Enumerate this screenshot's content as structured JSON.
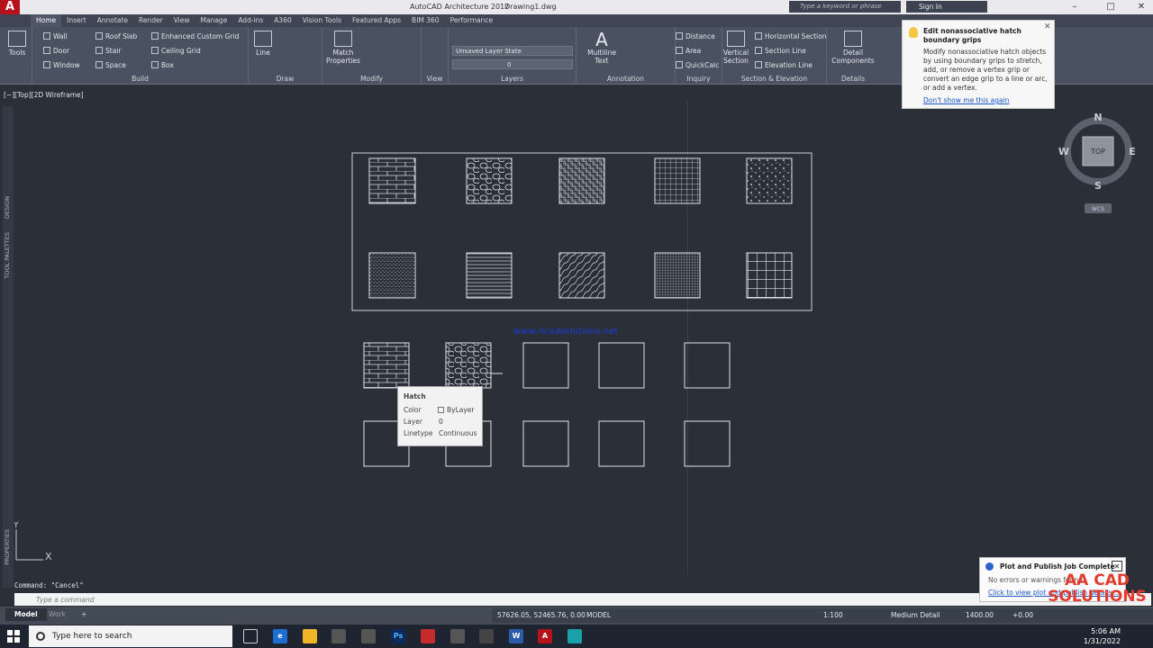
{
  "app": {
    "title": "AutoCAD Architecture 2017",
    "document": "Drawing1.dwg",
    "logo_letter": "A",
    "search_placeholder": "Type a keyword or phrase",
    "signin_label": "Sign In"
  },
  "tabs": [
    "Home",
    "Insert",
    "Annotate",
    "Render",
    "View",
    "Manage",
    "Add-ins",
    "A360",
    "Vision Tools",
    "Featured Apps",
    "BIM 360",
    "Performance"
  ],
  "ribbon": {
    "tools_label": "Tools",
    "build": {
      "label": "Build",
      "items": [
        "Wall",
        "Door",
        "Window",
        "Roof Slab",
        "Stair",
        "Space",
        "Enhanced Custom Grid",
        "Ceiling Grid",
        "Box"
      ]
    },
    "draw": {
      "label": "Draw",
      "line": "Line"
    },
    "modify": {
      "label": "Modify",
      "match_properties": "Match Properties"
    },
    "view": {
      "label": "View"
    },
    "layers": {
      "label": "Layers",
      "layer_state": "Unsaved Layer State",
      "current_layer": "0"
    },
    "annotation": {
      "label": "Annotation",
      "multiline_text": "Multiline Text"
    },
    "inquiry": {
      "label": "Inquiry",
      "items": [
        "Distance",
        "Area",
        "QuickCalc"
      ]
    },
    "section_elevation": {
      "label": "Section & Elevation",
      "vertical_section": "Vertical Section",
      "items": [
        "Horizontal Section",
        "Section Line",
        "Elevation Line"
      ]
    },
    "details": {
      "label": "Details",
      "detail_components": "Detail Components"
    }
  },
  "viewport": {
    "label": "[−][Top][2D Wireframe]",
    "viewcube": {
      "n": "N",
      "s": "S",
      "e": "E",
      "w": "W",
      "top": "TOP",
      "wcs": "WCS"
    },
    "ucs_y": "Y",
    "ucs_x": "X",
    "url_text": "www.ricadsolutions.net"
  },
  "palettes": {
    "design": "DESIGN",
    "tool_palettes": "TOOL PALETTES",
    "properties": "PROPERTIES"
  },
  "tooltip_grips": {
    "title": "Edit nonassociative hatch boundary grips",
    "body": "Modify nonassociative hatch objects by using boundary grips to stretch, add, or remove a vertex grip or convert an edge grip to a line or arc, or add a vertex.",
    "link": "Don't show me this again"
  },
  "hatch_tip": {
    "title": "Hatch",
    "rows": [
      {
        "k": "Color",
        "v": "ByLayer"
      },
      {
        "k": "Layer",
        "v": "0"
      },
      {
        "k": "Linetype",
        "v": "Continuous"
      }
    ]
  },
  "command": {
    "history": "Command: \"Cancel\"",
    "placeholder": "Type a command"
  },
  "layout_tabs": [
    "Model",
    "Work",
    "+"
  ],
  "status": {
    "coords": "57626.05, 52465.76, 0.00",
    "space": "MODEL",
    "scale": "1:100",
    "detail": "Medium Detail",
    "elevation": "1400.00",
    "offset": "+0.00"
  },
  "plot_tip": {
    "title": "Plot and Publish Job Complete",
    "body": "No errors or warnings found",
    "link": "Click to view plot and publish details..."
  },
  "watermark": {
    "line1": "AA CAD",
    "line2": "SOLUTIONS"
  },
  "taskbar": {
    "search_placeholder": "Type here to search",
    "time": "5:06 AM",
    "date": "1/31/2022"
  },
  "colors": {
    "canvas": "#2a2f38",
    "accent_red": "#b5121b",
    "link_blue": "#1a57c8"
  }
}
